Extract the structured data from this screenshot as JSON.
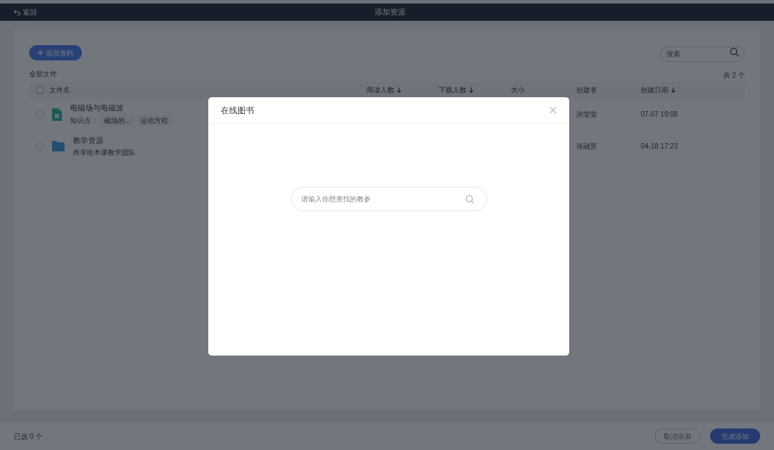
{
  "header": {
    "back": "返回",
    "title": "添加资源"
  },
  "toolbar": {
    "add_button": "添加资料",
    "search": {
      "placeholder": "搜索"
    }
  },
  "breadcrumb": "全部文件",
  "all_checked": false,
  "count": "共 2 个",
  "table": {
    "columns": [
      {
        "label": "文件名",
        "sortable": false
      },
      {
        "label": "阅读人数",
        "sortable": true
      },
      {
        "label": "下载人数",
        "sortable": true
      },
      {
        "label": "大小",
        "sortable": false
      },
      {
        "label": "创建者",
        "sortable": false
      },
      {
        "label": "创建日期",
        "sortable": true
      }
    ],
    "rows": [
      {
        "kind": "document",
        "name": "电磁场与电磁波",
        "checked": false,
        "subtitle_label": "知识点：",
        "tags": [
          "磁场的...",
          "运动方程"
        ],
        "creator": "洪莹莹",
        "date": "07-07 19:08"
      },
      {
        "kind": "folder",
        "name": "教学资源",
        "checked": false,
        "subtitle": "共享给本课教学团队",
        "creator": "张融慧",
        "date": "04-18 17:23"
      }
    ]
  },
  "footer": {
    "selected": "已选 0 个",
    "cancel": "取消添加",
    "confirm": "完成添加"
  },
  "dialog": {
    "title": "在线图书",
    "search": {
      "placeholder": "请输入你想查找的教参"
    }
  }
}
